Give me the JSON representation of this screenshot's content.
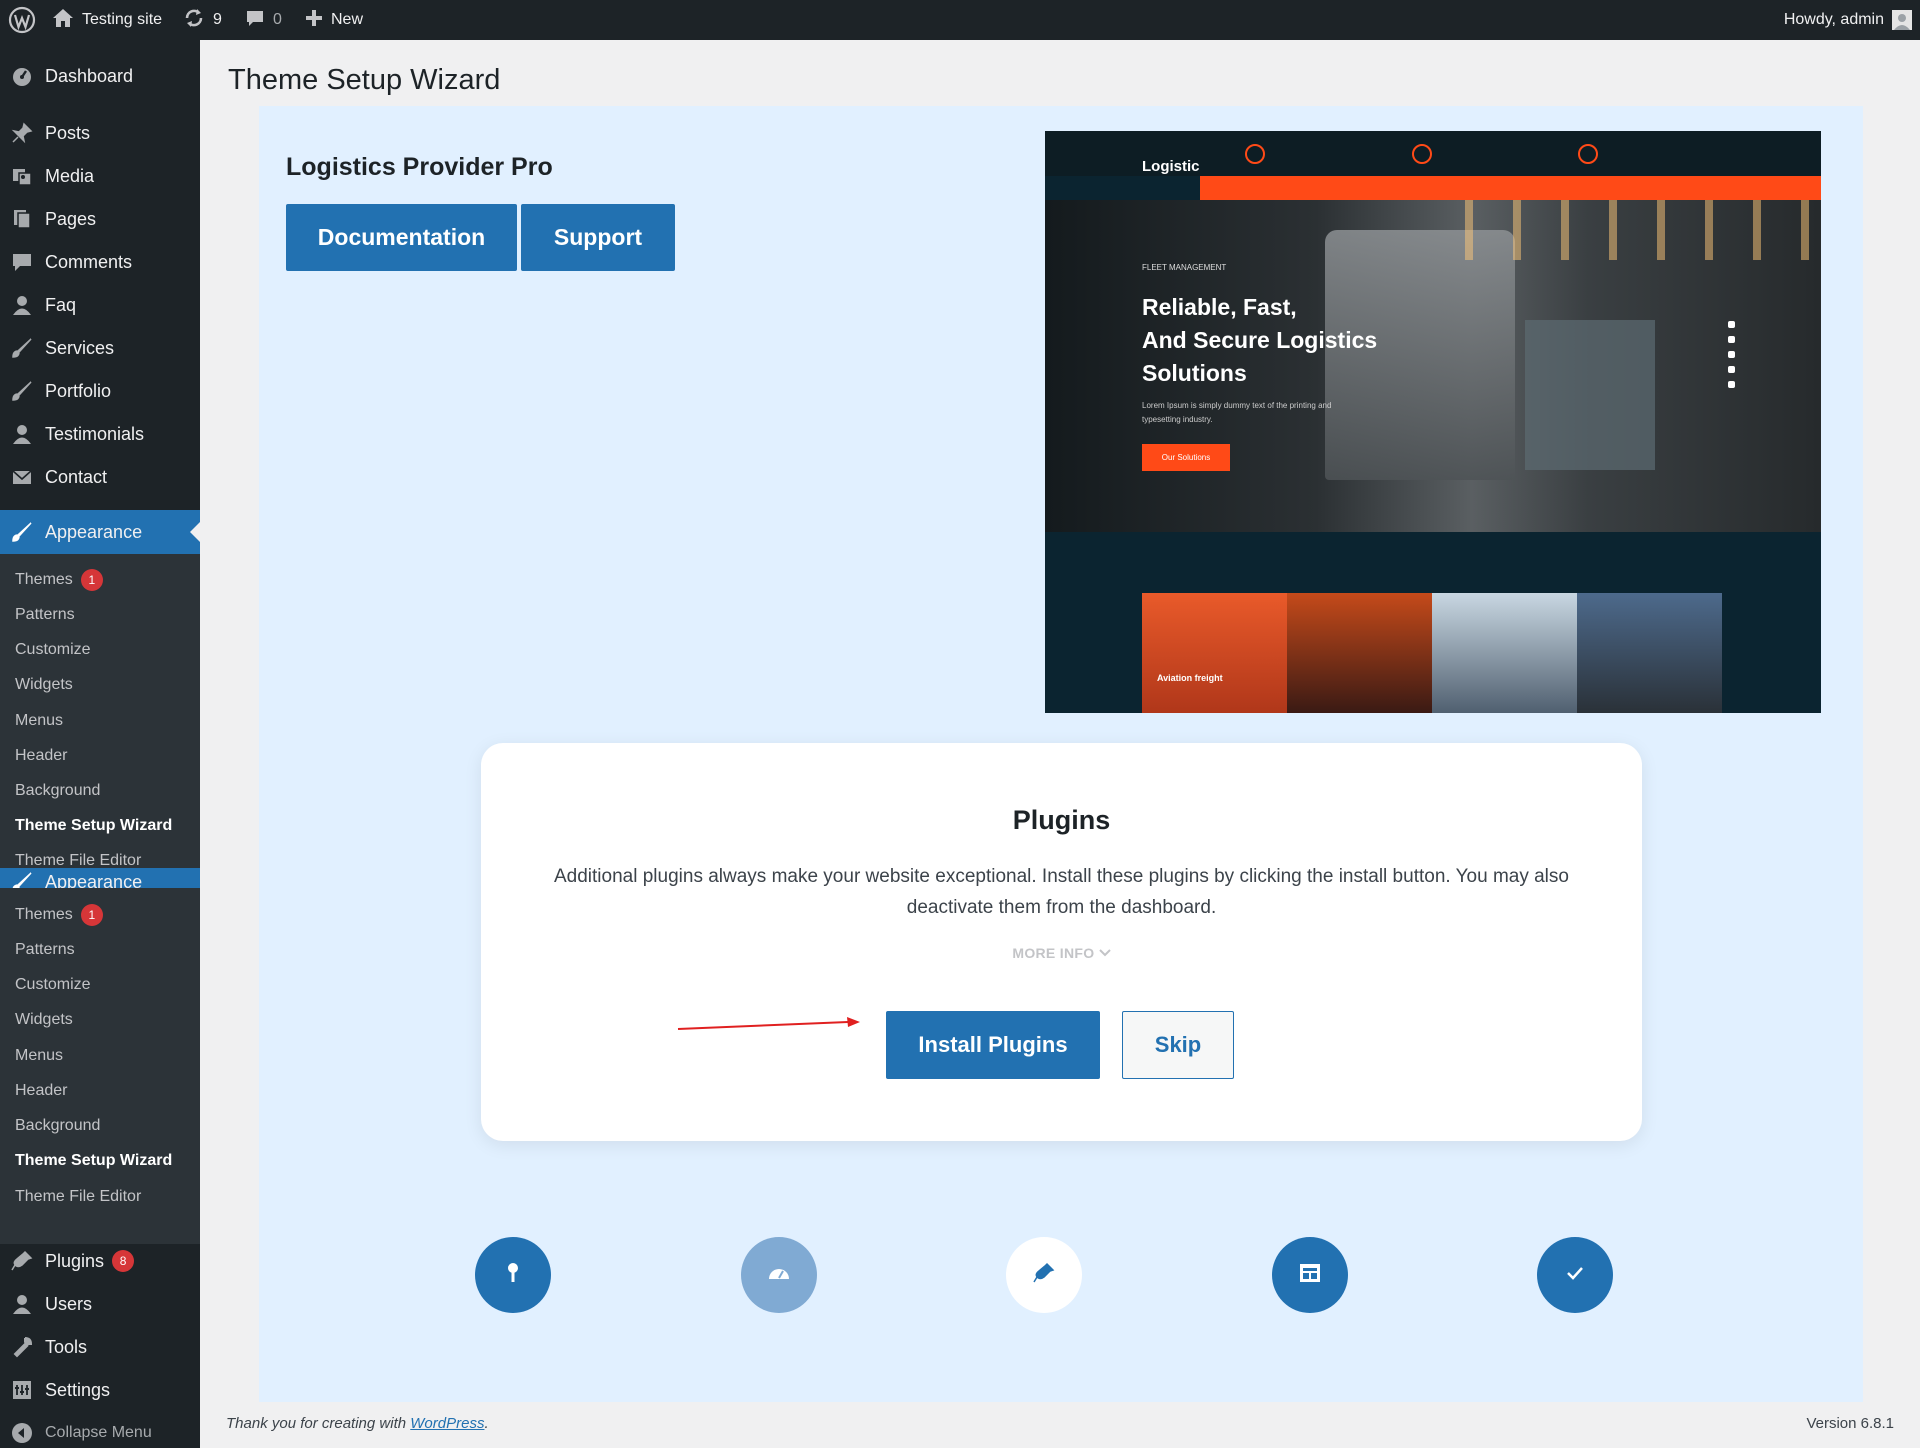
{
  "adminbar": {
    "site_name": "Testing site",
    "updates_count": "9",
    "comments_count": "0",
    "new_label": "New",
    "howdy": "Howdy, admin"
  },
  "sidebar": {
    "top_items": [
      {
        "label": "Dashboard",
        "icon": "dashboard-icon"
      },
      {
        "label": "Posts",
        "icon": "pin-icon"
      },
      {
        "label": "Media",
        "icon": "media-icon"
      },
      {
        "label": "Pages",
        "icon": "pages-icon"
      },
      {
        "label": "Comments",
        "icon": "comment-icon"
      },
      {
        "label": "Faq",
        "icon": "person-icon"
      },
      {
        "label": "Services",
        "icon": "brush-icon"
      },
      {
        "label": "Portfolio",
        "icon": "brush-icon"
      },
      {
        "label": "Testimonials",
        "icon": "person-icon"
      },
      {
        "label": "Contact",
        "icon": "mail-icon"
      }
    ],
    "appearance_label": "Appearance",
    "appearance_sub": [
      {
        "label": "Themes",
        "badge": "1"
      },
      {
        "label": "Patterns"
      },
      {
        "label": "Customize"
      },
      {
        "label": "Widgets"
      },
      {
        "label": "Menus"
      },
      {
        "label": "Header"
      },
      {
        "label": "Background"
      },
      {
        "label": "Theme Setup Wizard"
      },
      {
        "label": "Theme File Editor"
      }
    ],
    "plugins_label": "Plugins",
    "plugins_badge": "8",
    "users_label": "Users",
    "tools_label": "Tools",
    "settings_label": "Settings",
    "collapse_label": "Collapse Menu"
  },
  "page": {
    "title": "Theme Setup Wizard",
    "theme_name": "Logistics Provider Pro",
    "documentation_label": "Documentation",
    "support_label": "Support"
  },
  "preview": {
    "logo": "Logistic",
    "eyebrow": "FLEET MANAGEMENT",
    "headline_1": "Reliable, Fast,",
    "headline_2": "And Secure Logistics",
    "headline_3": "Solutions",
    "body": "Lorem Ipsum is simply dummy text of the printing and typesetting industry.",
    "cta": "Our Solutions",
    "card_label": "Aviation freight"
  },
  "plugins_card": {
    "title": "Plugins",
    "description": "Additional plugins always make your website exceptional. Install these plugins by clicking the install button. You may also deactivate them from the dashboard.",
    "more_info": "MORE INFO",
    "install_label": "Install Plugins",
    "skip_label": "Skip"
  },
  "steps": [
    {
      "icon": "key-icon",
      "state": "done"
    },
    {
      "icon": "dashboard-icon",
      "state": "done"
    },
    {
      "icon": "plugin-icon",
      "state": "current"
    },
    {
      "icon": "widgets-icon",
      "state": "pending"
    },
    {
      "icon": "check-icon",
      "state": "pending"
    }
  ],
  "footer": {
    "thanks_prefix": "Thank you for creating with ",
    "wordpress_link": "WordPress",
    "thanks_suffix": ".",
    "version": "Version 6.8.1"
  },
  "colors": {
    "accent": "#2271b1",
    "sidebar_bg": "#1d2327",
    "panel_bg": "#e1f0ff",
    "badge_red": "#d63638",
    "preview_orange": "#ff4a17"
  }
}
